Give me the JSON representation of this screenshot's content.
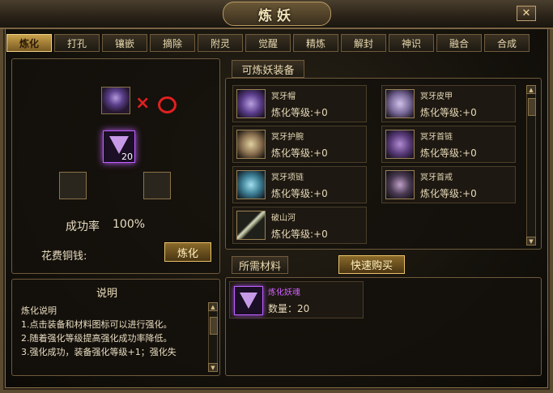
{
  "window": {
    "title": "炼妖",
    "close_label": "✕"
  },
  "tabs": [
    {
      "label": "炼化"
    },
    {
      "label": "打孔"
    },
    {
      "label": "镶嵌"
    },
    {
      "label": "摘除"
    },
    {
      "label": "附灵"
    },
    {
      "label": "觉醒"
    },
    {
      "label": "精炼"
    },
    {
      "label": "解封"
    },
    {
      "label": "神识"
    },
    {
      "label": "融合"
    },
    {
      "label": "合成"
    }
  ],
  "left": {
    "crystal_count": "20",
    "success_label": "成功率",
    "success_value": "100%",
    "cost_label": "花费铜钱:",
    "refine_button": "炼化"
  },
  "description": {
    "title": "说明",
    "heading": "炼化说明",
    "lines": [
      "1.点击装备和材料图标可以进行强化。",
      "2.随着强化等级提高强化成功率降低。",
      "3.强化成功，装备强化等级+1；强化失"
    ]
  },
  "equipment": {
    "tab_label": "可炼妖装备",
    "items": [
      {
        "name": "冥牙帽",
        "level": "炼化等级:+0",
        "icon": "helmet-icon",
        "color": "#8a68c8"
      },
      {
        "name": "冥牙皮甲",
        "level": "炼化等级:+0",
        "icon": "armor-icon",
        "color": "#8e7aa8"
      },
      {
        "name": "冥牙护腕",
        "level": "炼化等级:+0",
        "icon": "bracer-icon",
        "color": "#b4a080"
      },
      {
        "name": "冥牙首链",
        "level": "炼化等级:+0",
        "icon": "necklace-icon",
        "color": "#7a5a9e"
      },
      {
        "name": "冥牙项链",
        "level": "炼化等级:+0",
        "icon": "pendant-icon",
        "color": "#4a9ab0"
      },
      {
        "name": "冥牙首戒",
        "level": "炼化等级:+0",
        "icon": "ring-icon",
        "color": "#6a5070"
      },
      {
        "name": "破山河",
        "level": "炼化等级:+0",
        "icon": "spear-icon",
        "color": "#a0a880"
      }
    ]
  },
  "materials": {
    "tab_label": "所需材料",
    "quick_buy": "快速购买",
    "item": {
      "name": "炼化妖魂",
      "count": "数量：20",
      "name_color": "#d060ff"
    }
  },
  "colors": {
    "accent_gold": "#c9a24c",
    "error_red": "#e02020",
    "purple": "#c060ff"
  }
}
